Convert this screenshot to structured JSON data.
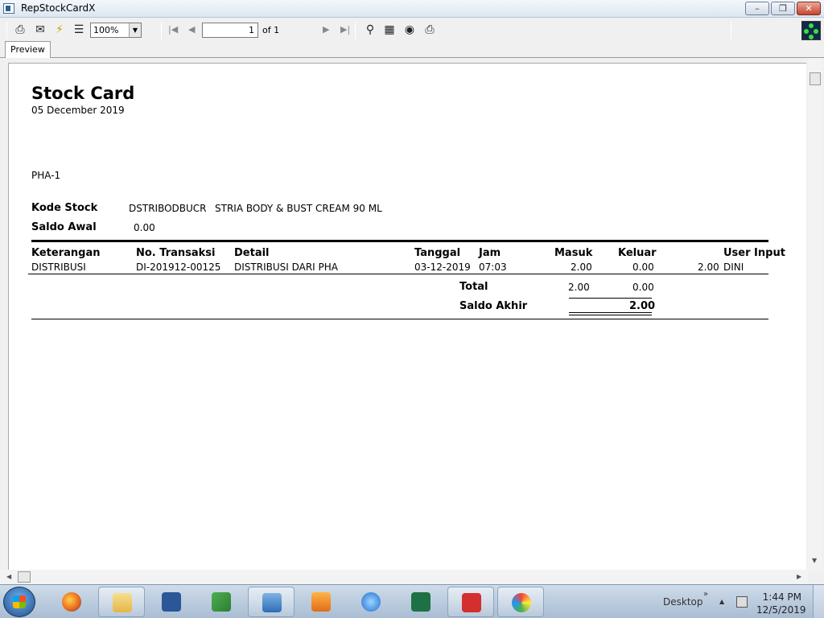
{
  "window": {
    "title": "RepStockCardX"
  },
  "toolbar": {
    "zoom": "100%",
    "page_current": "1",
    "page_of": "of 1",
    "tab_preview": "Preview"
  },
  "report": {
    "title": "Stock Card",
    "date": "05 December 2019",
    "location": "PHA-1",
    "kode_stock_label": "Kode Stock",
    "kode_stock_code": "DSTRIBODBUCR",
    "kode_stock_name": "STRIA BODY & BUST CREAM 90 ML",
    "saldo_awal_label": "Saldo Awal",
    "saldo_awal_value": "0.00",
    "columns": [
      "Keterangan",
      "No. Transaksi",
      "Detail",
      "Tanggal",
      "Jam",
      "Masuk",
      "Keluar",
      "User Input"
    ],
    "rows": [
      {
        "keterangan": "DISTRIBUSI",
        "no_transaksi": "DI-201912-00125",
        "detail": "DISTRIBUSI DARI PHA",
        "tanggal": "03-12-2019",
        "jam": "07:03",
        "masuk": "2.00",
        "keluar": "0.00",
        "saldo": "2.00",
        "user": "DINI"
      }
    ],
    "total_label": "Total",
    "total_masuk": "2.00",
    "total_keluar": "0.00",
    "saldo_akhir_label": "Saldo Akhir",
    "saldo_akhir_value": "2.00"
  },
  "taskbar": {
    "desktop_label": "Desktop",
    "time": "1:44 PM",
    "date": "12/5/2019"
  }
}
